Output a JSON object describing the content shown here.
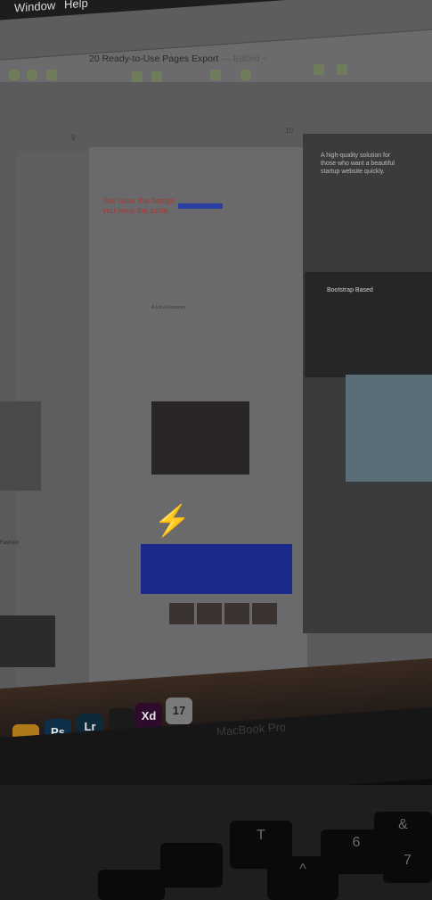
{
  "menubar": {
    "items": [
      "Window",
      "Help"
    ]
  },
  "document": {
    "title": "20 Ready-to-Use Pages Export",
    "status": "— Edited ~"
  },
  "artboards": {
    "mid_number": "9",
    "right_number": "10",
    "mid_hero": [
      "You have the design,",
      "you have the code."
    ],
    "mid_section": "A Lot of Features",
    "right_hero": "A high-quality solution for those who want a beautiful startup website quickly.",
    "right_section": "Bootstrap Based",
    "left_text": "Fashion"
  },
  "dock": {
    "icons": [
      {
        "name": "sketch-icon",
        "label": ""
      },
      {
        "name": "photoshop-icon",
        "label": "Ps"
      },
      {
        "name": "lightroom-icon",
        "label": "Lr"
      },
      {
        "name": "figma-icon",
        "label": ""
      },
      {
        "name": "xd-icon",
        "label": "Xd"
      },
      {
        "name": "calendar-icon",
        "label": "17"
      }
    ]
  },
  "laptop": {
    "brand": "MacBook Pro"
  },
  "keyboard": {
    "keys": [
      "T",
      "^",
      "6",
      "&",
      "7"
    ]
  }
}
